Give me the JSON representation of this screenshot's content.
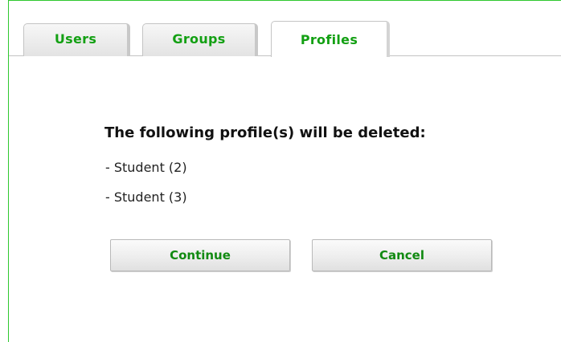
{
  "tabs": [
    {
      "label": "Users",
      "active": false
    },
    {
      "label": "Groups",
      "active": false
    },
    {
      "label": "Profiles",
      "active": true
    }
  ],
  "dialog": {
    "heading": "The following profile(s) will be deleted:",
    "items": [
      "- Student (2)",
      "- Student (3)"
    ],
    "continue_label": "Continue",
    "cancel_label": "Cancel"
  },
  "colors": {
    "accent_green": "#13a013",
    "frame_border": "#2ec82e"
  }
}
